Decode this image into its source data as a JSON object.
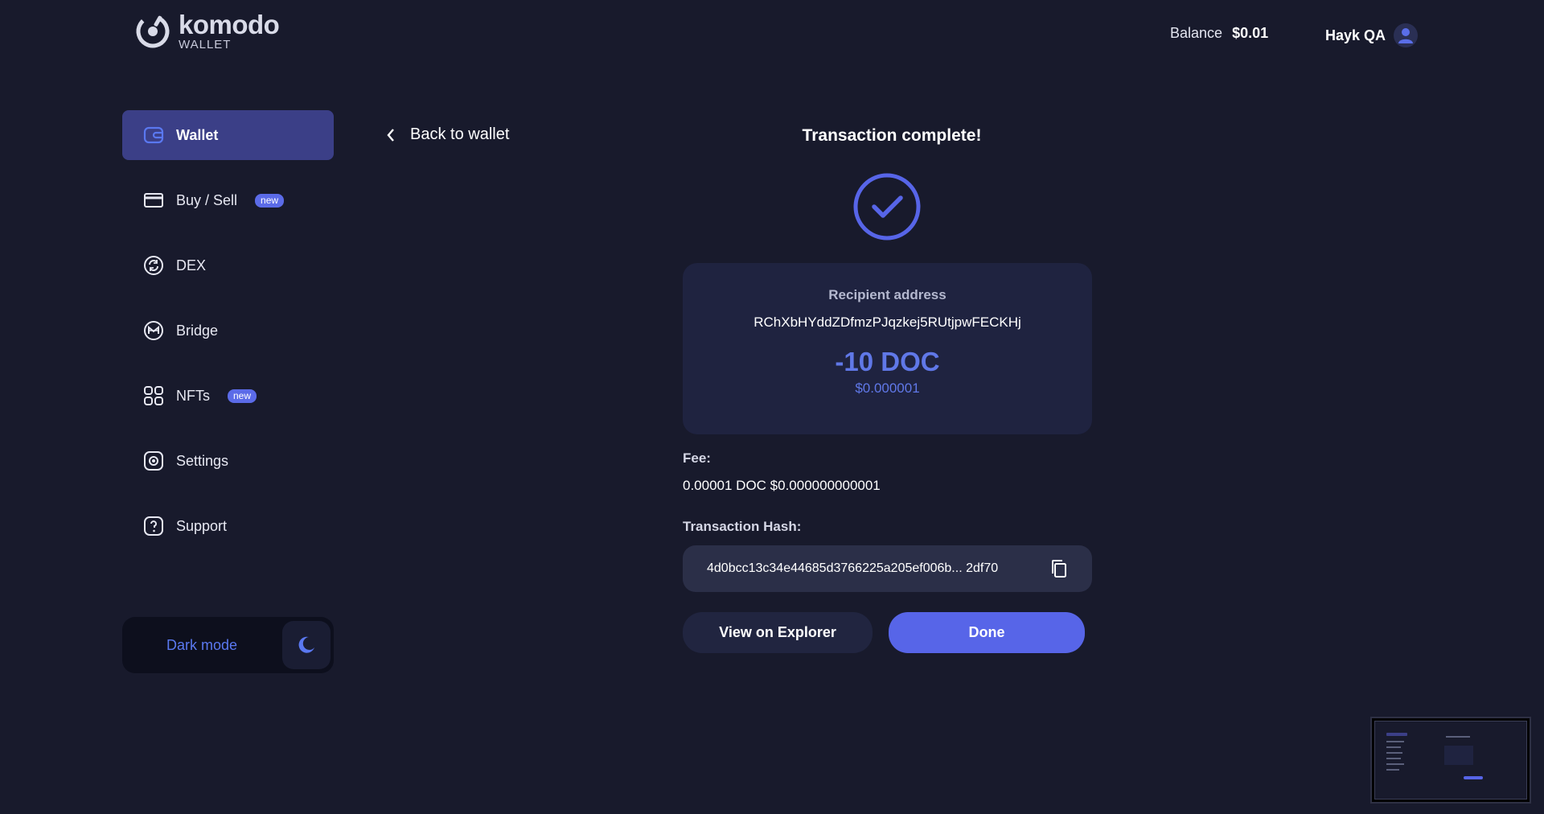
{
  "header": {
    "logo_name": "komodo",
    "logo_sub": "WALLET",
    "balance_label": "Balance",
    "balance_value": "$0.01",
    "user_name": "Hayk QA"
  },
  "sidebar": {
    "items": [
      {
        "label": "Wallet",
        "icon": "wallet-icon",
        "active": true
      },
      {
        "label": "Buy / Sell",
        "icon": "card-icon",
        "badge": "new"
      },
      {
        "label": "DEX",
        "icon": "swap-icon"
      },
      {
        "label": "Bridge",
        "icon": "bridge-icon"
      },
      {
        "label": "NFTs",
        "icon": "grid-icon",
        "badge": "new"
      },
      {
        "label": "Settings",
        "icon": "gear-icon"
      },
      {
        "label": "Support",
        "icon": "help-icon"
      }
    ],
    "dark_mode_label": "Dark mode"
  },
  "back": {
    "label": "Back to wallet"
  },
  "transaction": {
    "title": "Transaction complete!",
    "recipient_label": "Recipient address",
    "recipient_address": "RChXbHYddZDfmzPJqzkej5RUtjpwFECKHj",
    "amount": "-10 DOC",
    "amount_usd": "$0.000001",
    "fee_label": "Fee:",
    "fee_value": "0.00001 DOC $0.000000000001",
    "hash_label": "Transaction Hash:",
    "hash_value": "4d0bcc13c34e44685d3766225a205ef006b... 2df70"
  },
  "actions": {
    "explorer_label": "View on Explorer",
    "done_label": "Done"
  },
  "colors": {
    "background": "#181a2c",
    "accent": "#5765e8",
    "active_nav": "#3b3f87"
  }
}
